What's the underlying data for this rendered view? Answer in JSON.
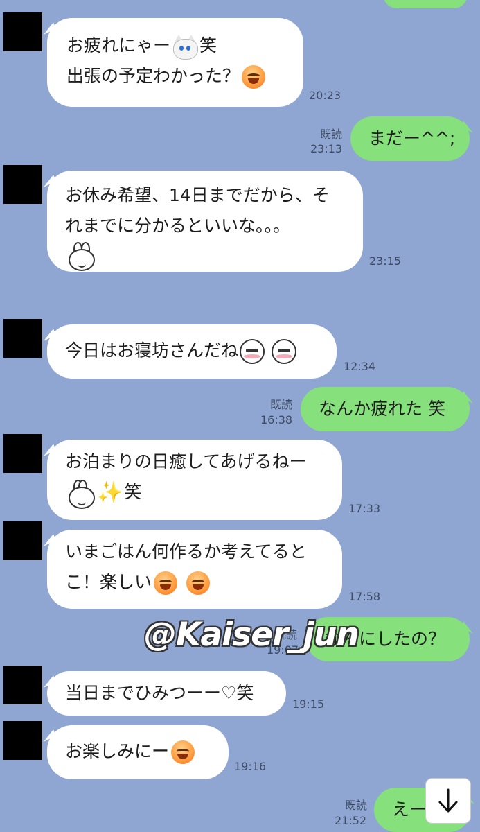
{
  "messages": [
    {
      "lines": [
        "お疲れにゃー",
        "笑",
        "出張の予定わかった？"
      ],
      "time": "20:23"
    },
    {
      "text": "まだー^^;",
      "read": "既読",
      "time": "23:13"
    },
    {
      "lines": [
        "お休み希望、14日までだから、そ",
        "れまでに分かるといいな。。。"
      ],
      "time": "23:15"
    },
    {
      "text": "今日はお寝坊さんだね",
      "time": "12:34"
    },
    {
      "text": "なんか疲れた 笑",
      "read": "既読",
      "time": "16:38"
    },
    {
      "lines": [
        "お泊まりの日癒してあげるねー",
        "笑"
      ],
      "time": "17:33"
    },
    {
      "lines": [
        "いまごはん何作るか考えてると",
        "こ！楽しい"
      ],
      "time": "17:58"
    },
    {
      "text": "なんにしたの？",
      "read": "既読",
      "time": "19:07"
    },
    {
      "text": "当日までひみつーー♡笑",
      "time": "19:15"
    },
    {
      "text": "お楽しみにー",
      "time": "19:16"
    },
    {
      "text": "えー",
      "read": "既読",
      "time": "21:52"
    }
  ],
  "watermark": "@Kaiser_jun",
  "icons": {
    "scroll": "arrow-down-icon",
    "sparkle": "✨"
  }
}
